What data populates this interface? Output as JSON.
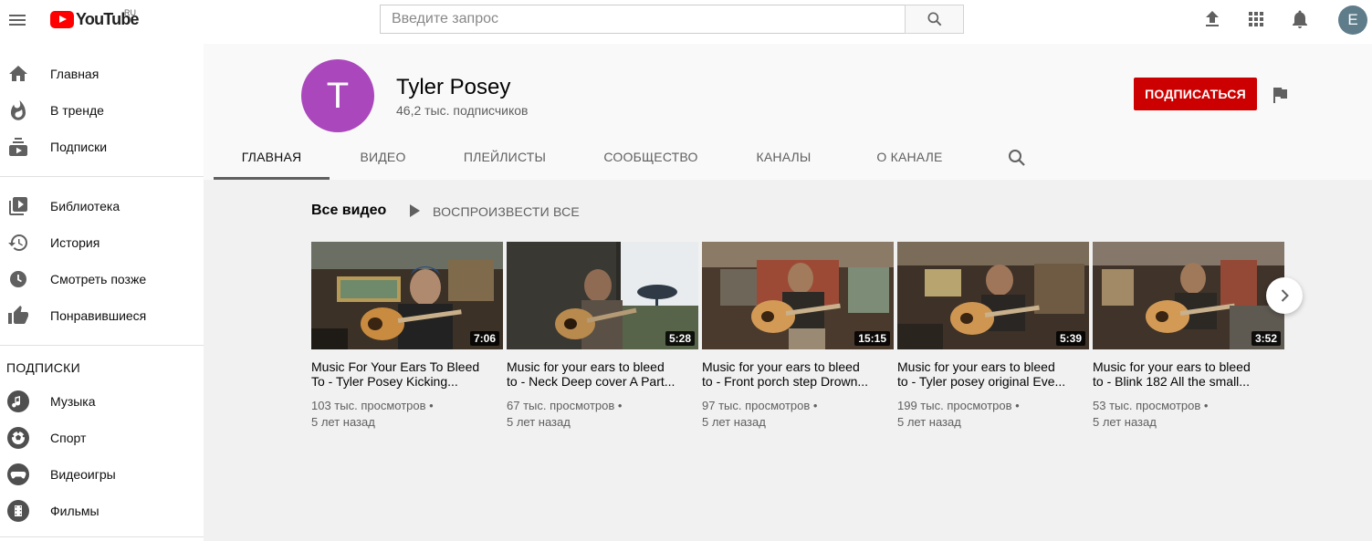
{
  "header": {
    "logo_text": "YouTube",
    "logo_region": "RU",
    "search_placeholder": "Введите запрос",
    "avatar_letter": "E"
  },
  "sidebar": {
    "main": [
      {
        "label": "Главная",
        "icon": "home-icon"
      },
      {
        "label": "В тренде",
        "icon": "trending-icon"
      },
      {
        "label": "Подписки",
        "icon": "subscriptions-icon"
      }
    ],
    "library": [
      {
        "label": "Библиотека",
        "icon": "library-icon"
      },
      {
        "label": "История",
        "icon": "history-icon"
      },
      {
        "label": "Смотреть позже",
        "icon": "watch-later-icon"
      },
      {
        "label": "Понравившиеся",
        "icon": "liked-icon"
      }
    ],
    "subscriptions_heading": "ПОДПИСКИ",
    "subscriptions": [
      {
        "label": "Музыка",
        "icon": "music-icon"
      },
      {
        "label": "Спорт",
        "icon": "sports-icon"
      },
      {
        "label": "Видеоигры",
        "icon": "gaming-icon"
      },
      {
        "label": "Фильмы",
        "icon": "movies-icon"
      }
    ]
  },
  "channel": {
    "avatar_letter": "T",
    "avatar_color": "#ab47bc",
    "name": "Tyler Posey",
    "subscribers": "46,2 тыс. подписчиков",
    "subscribe_label": "ПОДПИСАТЬСЯ",
    "subscribe_color": "#cc0000"
  },
  "tabs": [
    {
      "label": "ГЛАВНАЯ",
      "active": true
    },
    {
      "label": "ВИДЕО",
      "active": false
    },
    {
      "label": "ПЛЕЙЛИСТЫ",
      "active": false
    },
    {
      "label": "СООБЩЕСТВО",
      "active": false
    },
    {
      "label": "КАНАЛЫ",
      "active": false
    },
    {
      "label": "О КАНАЛЕ",
      "active": false
    }
  ],
  "section": {
    "title": "Все видео",
    "play_all": "ВОСПРОИЗВЕСТИ ВСЕ"
  },
  "videos": [
    {
      "title_line1": "Music For Your Ears To Bleed",
      "title_line2": "To - Tyler Posey Kicking...",
      "views": "103 тыс. просмотров •",
      "age": "5 лет назад",
      "duration": "7:06"
    },
    {
      "title_line1": "Music for your ears to bleed",
      "title_line2": "to - Neck Deep cover A Part...",
      "views": "67 тыс. просмотров •",
      "age": "5 лет назад",
      "duration": "5:28"
    },
    {
      "title_line1": "Music for your ears to bleed",
      "title_line2": "to - Front porch step Drown...",
      "views": "97 тыс. просмотров •",
      "age": "5 лет назад",
      "duration": "15:15"
    },
    {
      "title_line1": "Music for your ears to bleed",
      "title_line2": "to - Tyler posey original Eve...",
      "views": "199 тыс. просмотров •",
      "age": "5 лет назад",
      "duration": "5:39"
    },
    {
      "title_line1": "Music for your ears to bleed",
      "title_line2": "to - Blink 182 All the small...",
      "views": "53 тыс. просмотров •",
      "age": "5 лет назад",
      "duration": "3:52"
    }
  ]
}
